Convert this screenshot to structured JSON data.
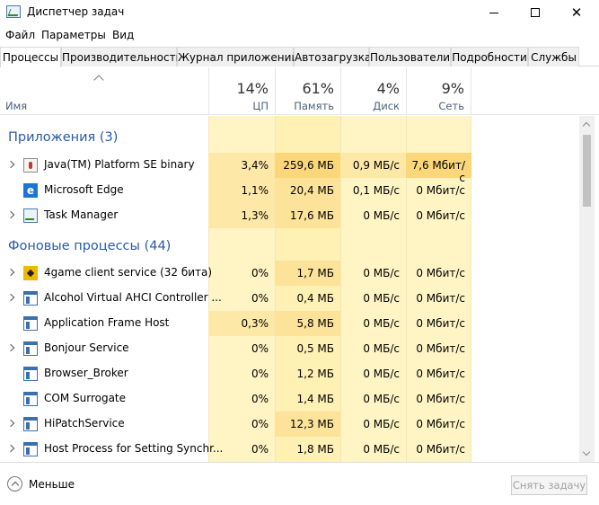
{
  "window": {
    "title": "Диспетчер задач"
  },
  "menu": [
    "Файл",
    "Параметры",
    "Вид"
  ],
  "tabs": [
    "Процессы",
    "Производительность",
    "Журнал приложений",
    "Автозагрузка",
    "Пользователи",
    "Подробности",
    "Службы"
  ],
  "header": {
    "name_label": "Имя",
    "cpu": {
      "pct": "14%",
      "label": "ЦП"
    },
    "memory": {
      "pct": "61%",
      "label": "Память"
    },
    "disk": {
      "pct": "4%",
      "label": "Диск"
    },
    "network": {
      "pct": "9%",
      "label": "Сеть"
    }
  },
  "groups": [
    {
      "title": "Приложения (3)"
    },
    {
      "title": "Фоновые процессы (44)"
    }
  ],
  "apps": [
    {
      "name": "Java(TM) Platform SE binary",
      "icon": "java-icon",
      "cpu": "3,4%",
      "mem": "259,6 МБ",
      "disk": "0,9 МБ/с",
      "net": "7,6 Мбит/с"
    },
    {
      "name": "Microsoft Edge",
      "icon": "edge-icon",
      "cpu": "1,1%",
      "mem": "20,4 МБ",
      "disk": "0,1 МБ/с",
      "net": "0 Мбит/с"
    },
    {
      "name": "Task Manager",
      "icon": "task-manager-icon",
      "cpu": "1,3%",
      "mem": "17,6 МБ",
      "disk": "0 МБ/с",
      "net": "0 Мбит/с"
    }
  ],
  "background": [
    {
      "name": "4game client service (32 бита)",
      "icon": "4game-icon",
      "cpu": "0%",
      "mem": "1,7 МБ",
      "disk": "0 МБ/с",
      "net": "0 Мбит/с"
    },
    {
      "name": "Alcohol Virtual AHCI Controller ...",
      "icon": "service-window-icon",
      "cpu": "0%",
      "mem": "0,4 МБ",
      "disk": "0 МБ/с",
      "net": "0 Мбит/с"
    },
    {
      "name": "Application Frame Host",
      "icon": "service-window-icon",
      "cpu": "0,3%",
      "mem": "5,8 МБ",
      "disk": "0 МБ/с",
      "net": "0 Мбит/с"
    },
    {
      "name": "Bonjour Service",
      "icon": "service-window-icon",
      "cpu": "0%",
      "mem": "0,5 МБ",
      "disk": "0 МБ/с",
      "net": "0 Мбит/с"
    },
    {
      "name": "Browser_Broker",
      "icon": "service-window-icon",
      "cpu": "0%",
      "mem": "1,2 МБ",
      "disk": "0 МБ/с",
      "net": "0 Мбит/с"
    },
    {
      "name": "COM Surrogate",
      "icon": "service-window-icon",
      "cpu": "0%",
      "mem": "1,4 МБ",
      "disk": "0 МБ/с",
      "net": "0 Мбит/с"
    },
    {
      "name": "HiPatchService",
      "icon": "service-window-icon",
      "cpu": "0%",
      "mem": "12,3 МБ",
      "disk": "0 МБ/с",
      "net": "0 Мбит/с"
    },
    {
      "name": "Host Process for Setting Synchr...",
      "icon": "service-window-icon",
      "cpu": "0%",
      "mem": "1,8 МБ",
      "disk": "0 МБ/с",
      "net": "0 Мбит/с"
    }
  ],
  "footer": {
    "less_label": "Меньше",
    "end_task_label": "Снять задачу"
  }
}
